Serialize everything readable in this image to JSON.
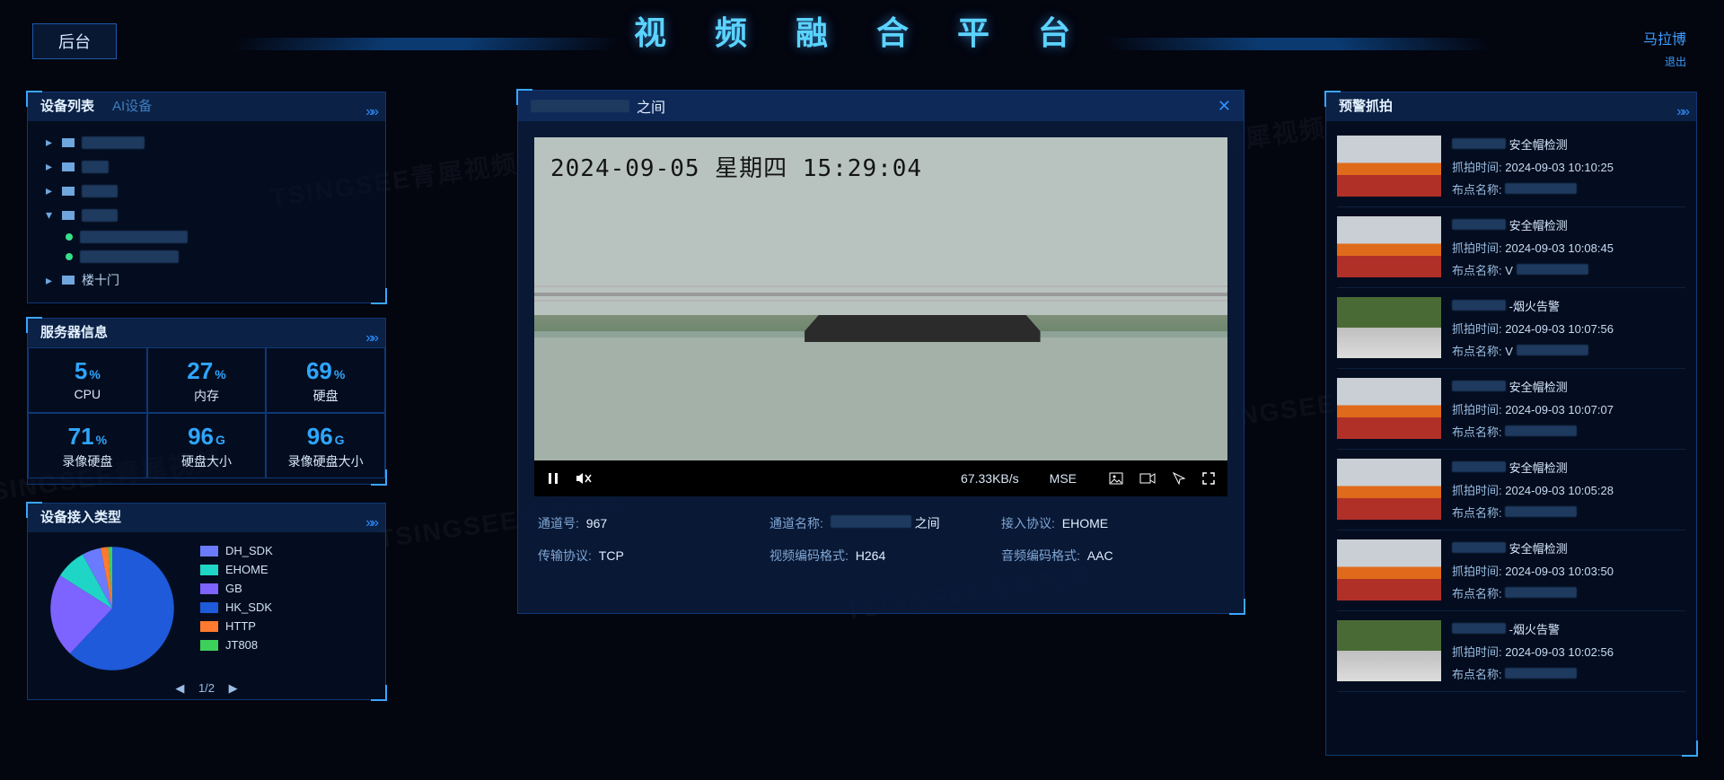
{
  "header": {
    "title": "视 频 融 合 平 台",
    "back_label": "后台",
    "user_name": "马拉博",
    "user_sub": "退出"
  },
  "watermark": "TSINGSEE青犀视频",
  "devices_panel": {
    "tab_devices": "设备列表",
    "tab_ai": "AI设备",
    "tree": [
      {
        "collapsed": true,
        "label_hidden": true,
        "label_w": 70
      },
      {
        "collapsed": true,
        "label_hidden": true,
        "label_w": 30
      },
      {
        "collapsed": true,
        "label_hidden": true,
        "label_w": 40
      },
      {
        "collapsed": false,
        "label_hidden": true,
        "label_w": 40,
        "children": [
          {
            "online": true,
            "label_hidden": true,
            "label_w": 120
          },
          {
            "online": true,
            "label_hidden": true,
            "label_w": 110
          }
        ]
      },
      {
        "collapsed": true,
        "label_visible": "楼十门",
        "truncated": true
      }
    ]
  },
  "server_panel": {
    "title": "服务器信息",
    "cells": [
      {
        "value": "5",
        "unit": "%",
        "label": "CPU"
      },
      {
        "value": "27",
        "unit": "%",
        "label": "内存"
      },
      {
        "value": "69",
        "unit": "%",
        "label": "硬盘"
      },
      {
        "value": "71",
        "unit": "%",
        "label": "录像硬盘"
      },
      {
        "value": "96",
        "unit": "G",
        "label": "硬盘大小"
      },
      {
        "value": "96",
        "unit": "G",
        "label": "录像硬盘大小"
      }
    ]
  },
  "types_panel": {
    "title": "设备接入类型",
    "legend": [
      {
        "name": "DH_SDK",
        "color": "#6a7bff"
      },
      {
        "name": "EHOME",
        "color": "#1fd6c6"
      },
      {
        "name": "GB",
        "color": "#7d63ff"
      },
      {
        "name": "HK_SDK",
        "color": "#1e5ad9"
      },
      {
        "name": "HTTP",
        "color": "#ff7a2e"
      },
      {
        "name": "JT808",
        "color": "#3bd15a"
      }
    ],
    "pager_prev": "◀",
    "pager_text": "1/2",
    "pager_next": "▶"
  },
  "chart_data": {
    "type": "pie",
    "title": "设备接入类型",
    "series": [
      {
        "name": "HK_SDK",
        "value": 62,
        "color": "#1e5ad9"
      },
      {
        "name": "GB",
        "value": 22,
        "color": "#7d63ff"
      },
      {
        "name": "EHOME",
        "value": 8,
        "color": "#1fd6c6"
      },
      {
        "name": "DH_SDK",
        "value": 5,
        "color": "#6a7bff"
      },
      {
        "name": "HTTP",
        "value": 2,
        "color": "#ff7a2e"
      },
      {
        "name": "JT808",
        "value": 1,
        "color": "#3bd15a"
      }
    ],
    "note": "percent values estimated from pie slice visual proportions; legend page 1/2 shown"
  },
  "video": {
    "title_suffix": "之间",
    "osd_timestamp": "2024-09-05  星期四  15:29:04",
    "bitrate": "67.33KB/s",
    "decoder": "MSE",
    "controls": {
      "pause": "pause",
      "mute": "mute",
      "snapshot": "snapshot",
      "record": "record",
      "ptz": "ptz",
      "fullscreen": "fullscreen"
    },
    "meta": {
      "channel_id_label": "通道号:",
      "channel_id": "967",
      "channel_name_label": "通道名称:",
      "channel_name_suffix": "之间",
      "access_proto_label": "接入协议:",
      "access_proto": "EHOME",
      "trans_proto_label": "传输协议:",
      "trans_proto": "TCP",
      "vcodec_label": "视频编码格式:",
      "vcodec": "H264",
      "acodec_label": "音频编码格式:",
      "acodec": "AAC"
    }
  },
  "alerts_panel": {
    "title": "预警抓拍",
    "time_label": "抓拍时间:",
    "site_label": "布点名称:",
    "fire_label": "-烟火告警",
    "safe_label": "安全帽检测",
    "items": [
      {
        "kind": "room",
        "type_key": "safe_label",
        "time": "2024-09-03 10:10:25",
        "site_hidden": true
      },
      {
        "kind": "room",
        "type_key": "safe_label",
        "time": "2024-09-03 10:08:45",
        "site_prefix": "V",
        "site_hidden": true
      },
      {
        "kind": "fire",
        "type_key": "fire_label",
        "time": "2024-09-03 10:07:56",
        "site_prefix": "V",
        "site_hidden": true
      },
      {
        "kind": "room",
        "type_key": "safe_label",
        "time": "2024-09-03 10:07:07",
        "site_hidden": true
      },
      {
        "kind": "room",
        "type_key": "safe_label",
        "time": "2024-09-03 10:05:28",
        "site_hidden": true
      },
      {
        "kind": "room",
        "type_key": "safe_label",
        "time": "2024-09-03 10:03:50",
        "site_hidden": true
      },
      {
        "kind": "fire",
        "type_key": "fire_label",
        "time": "2024-09-03 10:02:56",
        "site_hidden": true
      }
    ]
  }
}
